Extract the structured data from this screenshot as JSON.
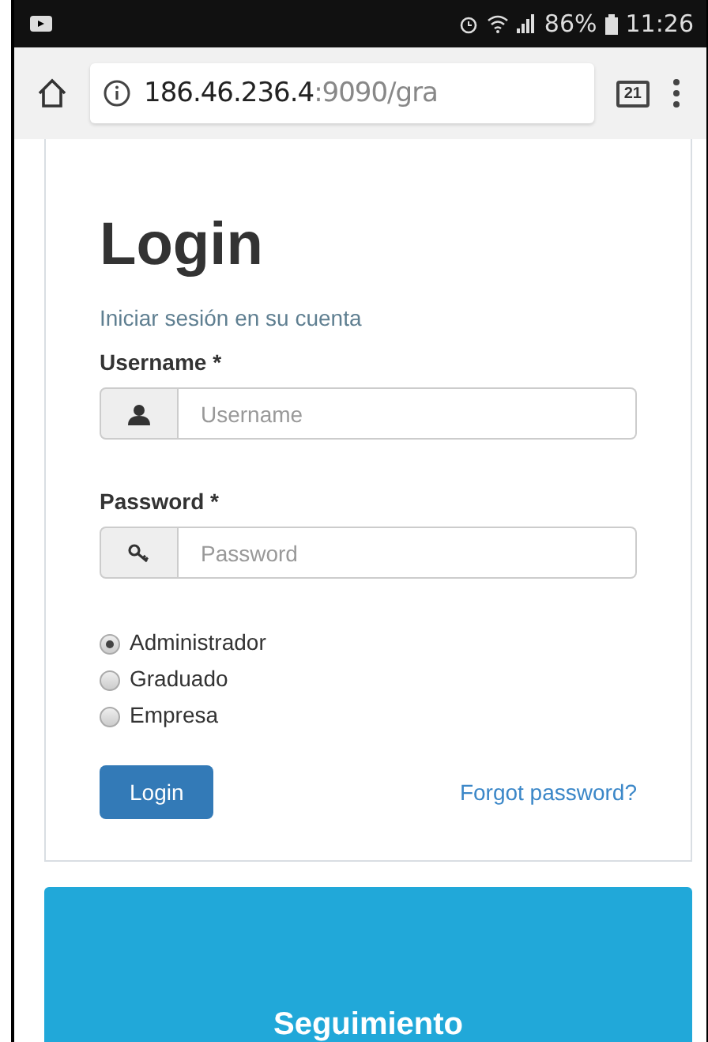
{
  "status_bar": {
    "battery": "86%",
    "time": "11:26"
  },
  "browser": {
    "url_host": "186.46.236.4",
    "url_rest": ":9090/gra",
    "tab_count": "21"
  },
  "login_card": {
    "title": "Login",
    "subtitle": "Iniciar sesión en su cuenta",
    "fields": [
      {
        "label": "Username *",
        "placeholder": "Username",
        "kind": "user"
      },
      {
        "label": "Password *",
        "placeholder": "Password",
        "kind": "password"
      }
    ],
    "roles": [
      {
        "label": "Administrador",
        "selected": true
      },
      {
        "label": "Graduado",
        "selected": false
      },
      {
        "label": "Empresa",
        "selected": false
      }
    ],
    "login_button": "Login",
    "forgot_link": "Forgot password?"
  },
  "banner": {
    "title": "Seguimiento"
  }
}
